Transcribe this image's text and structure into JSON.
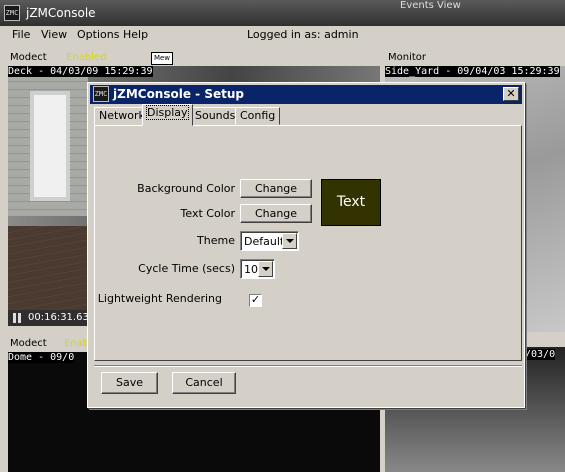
{
  "app": {
    "title": "jZMConsole",
    "logo_text": "ZMC",
    "partial_window_text": "Events View"
  },
  "menu": {
    "items": [
      "File",
      "View",
      "Options",
      "Help"
    ],
    "logged_in": "Logged in as: admin"
  },
  "monitors": [
    {
      "function": "Modect",
      "extra": "Enabled",
      "mew": "Mew",
      "osd": "Deck - 04/03/09 15:29:39",
      "status_time": "00:16:31.63"
    },
    {
      "function": "Monitor",
      "osd": "Side_Yard - 09/04/03 15:29:39"
    },
    {
      "function": "Modect",
      "extra": "Enabled",
      "osd": "Dome - 09/0"
    },
    {
      "osd": "/03/0"
    }
  ],
  "dialog": {
    "title": "jZMConsole - Setup",
    "close_glyph": "✕",
    "tabs": [
      "Network",
      "Display",
      "Sounds",
      "Config"
    ],
    "active_tab": "Display",
    "background_color_label": "Background Color",
    "text_color_label": "Text Color",
    "change_label": "Change",
    "preview_text": "Text",
    "preview_bg": "#333300",
    "preview_fg": "#ffffff",
    "theme_label": "Theme",
    "theme_value": "Default",
    "cycle_time_label": "Cycle Time (secs)",
    "cycle_time_value": "10",
    "lightweight_label": "Lightweight Rendering",
    "lightweight_checked": true,
    "check_glyph": "✓",
    "save_label": "Save",
    "cancel_label": "Cancel"
  },
  "colors": {
    "titlebar": "#0a246a",
    "window_bg": "#d4d0c8"
  }
}
